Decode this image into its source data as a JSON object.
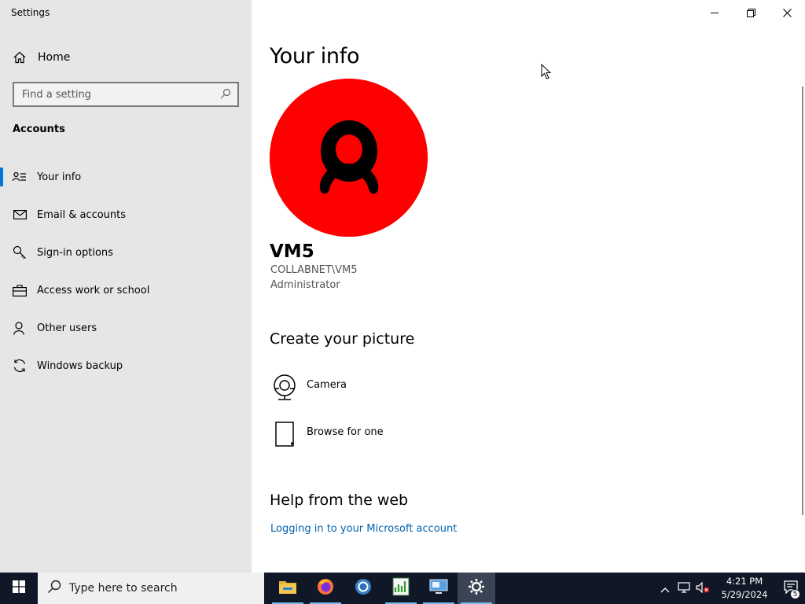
{
  "window": {
    "title": "Settings",
    "controls": {
      "minimize": "minimize-icon",
      "restore": "restore-icon",
      "close": "close-icon"
    }
  },
  "sidebar": {
    "home_label": "Home",
    "search_placeholder": "Find a setting",
    "section_title": "Accounts",
    "items": [
      {
        "label": "Your info",
        "icon": "your-info-icon",
        "selected": true
      },
      {
        "label": "Email & accounts",
        "icon": "mail-icon",
        "selected": false
      },
      {
        "label": "Sign-in options",
        "icon": "key-icon",
        "selected": false
      },
      {
        "label": "Access work or school",
        "icon": "briefcase-icon",
        "selected": false
      },
      {
        "label": "Other users",
        "icon": "person-icon",
        "selected": false
      },
      {
        "label": "Windows backup",
        "icon": "sync-icon",
        "selected": false
      }
    ]
  },
  "main": {
    "title": "Your info",
    "user": {
      "name": "VM5",
      "domain": "COLLABNET\\VM5",
      "role": "Administrator"
    },
    "create_picture": {
      "heading": "Create your picture",
      "options": [
        {
          "label": "Camera",
          "icon": "camera-icon"
        },
        {
          "label": "Browse for one",
          "icon": "document-icon"
        }
      ]
    },
    "help": {
      "heading": "Help from the web",
      "link": "Logging in to your Microsoft account"
    }
  },
  "taskbar": {
    "search_placeholder": "Type here to search",
    "apps": [
      "file-explorer-icon",
      "firefox-icon",
      "chrome-icon",
      "spreadsheet-icon",
      "remote-desktop-icon",
      "settings-gear-icon"
    ],
    "time": "4:21 PM",
    "date": "5/29/2024",
    "notification_count": "5"
  },
  "colors": {
    "accent": "#0078d7",
    "avatar": "#fe0000",
    "taskbar": "#101827",
    "link": "#0063b1"
  }
}
